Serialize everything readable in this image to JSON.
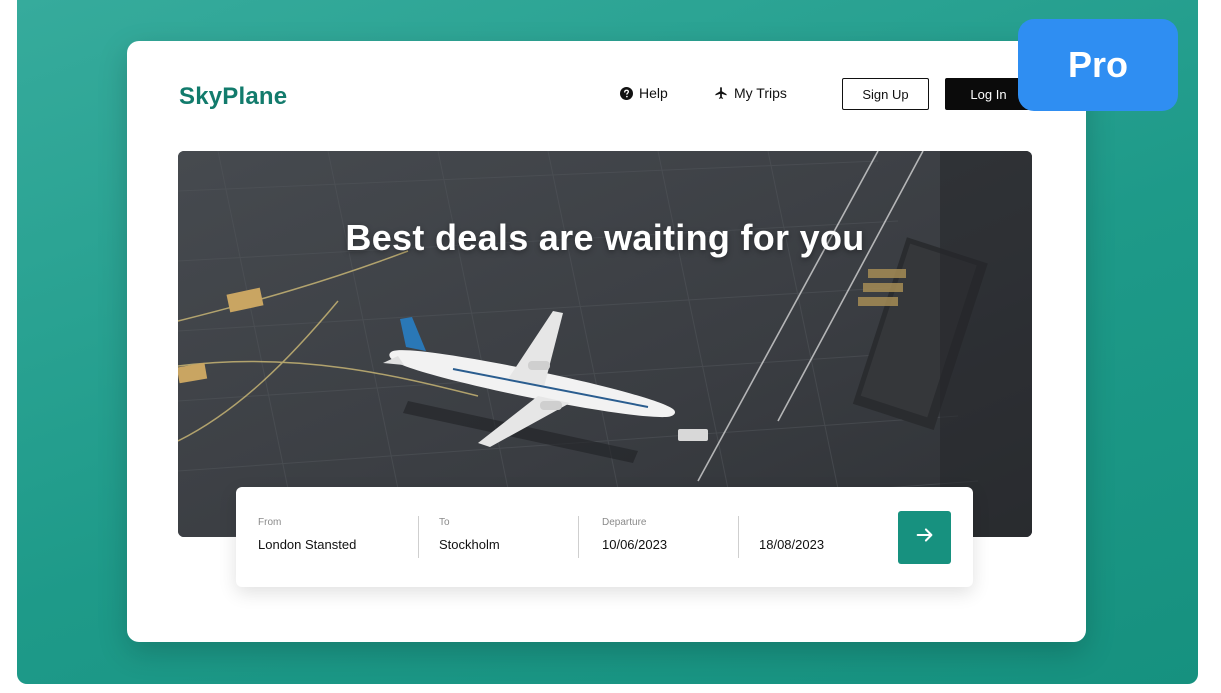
{
  "brand": {
    "name": "SkyPlane"
  },
  "nav": {
    "help_label": "Help",
    "trips_label": "My Trips",
    "signup_label": "Sign Up",
    "login_label": "Log In"
  },
  "hero": {
    "title": "Best deals are waiting for you"
  },
  "search": {
    "from": {
      "label": "From",
      "value": "London Stansted"
    },
    "to": {
      "label": "To",
      "value": "Stockholm"
    },
    "departure": {
      "label": "Departure",
      "value": "10/06/2023"
    },
    "return": {
      "label": "",
      "value": "18/08/2023"
    }
  },
  "badge": {
    "label": "Pro"
  },
  "colors": {
    "accent": "#17917f",
    "brand_text": "#127b6c",
    "badge": "#2f8ef2",
    "background": "#1e9a89"
  },
  "icons": {
    "help": "question-circle-icon",
    "trips": "airplane-icon",
    "submit": "arrow-right-icon"
  }
}
